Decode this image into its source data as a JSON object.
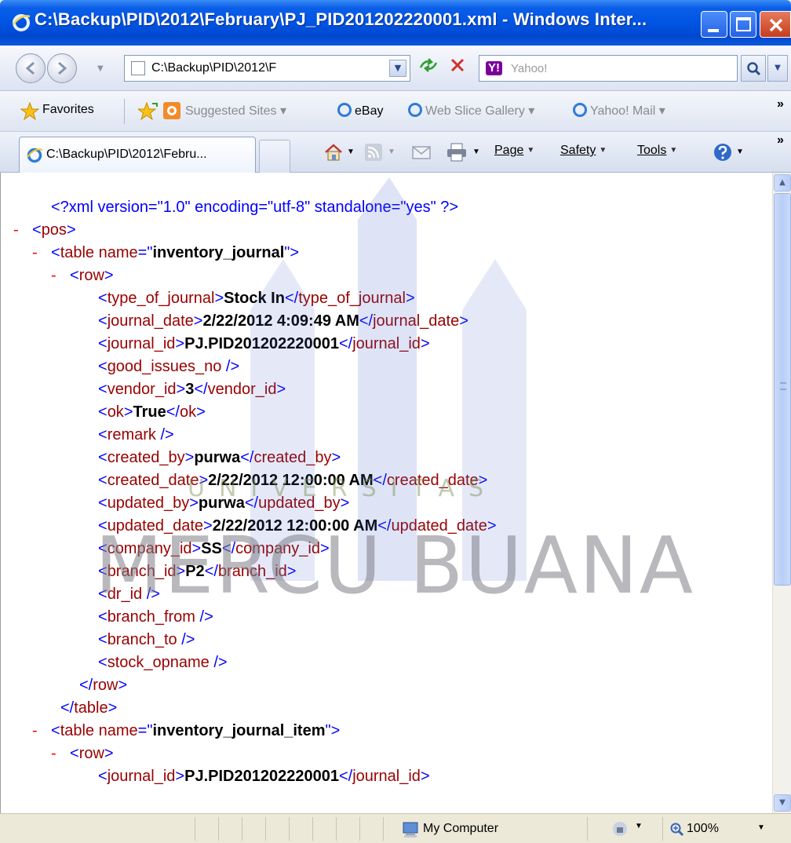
{
  "window": {
    "title": "C:\\Backup\\PID\\2012\\February\\PJ_PID201202220001.xml - Windows Inter..."
  },
  "nav": {
    "address": "C:\\Backup\\PID\\2012\\F",
    "search_placeholder": "Yahoo!",
    "search_provider": "Y!"
  },
  "favorites": {
    "label": "Favorites",
    "items": [
      {
        "label": "Suggested Sites ▾"
      },
      {
        "label": "eBay"
      },
      {
        "label": "Web Slice Gallery ▾"
      },
      {
        "label": "Yahoo! Mail ▾"
      }
    ],
    "overflow": "»"
  },
  "tab": {
    "label": "C:\\Backup\\PID\\2012\\Febru..."
  },
  "commands": {
    "page": "Page",
    "safety": "Safety",
    "tools": "Tools"
  },
  "xml": {
    "declaration": "<?xml version=\"1.0\" encoding=\"utf-8\" standalone=\"yes\" ?>",
    "root": "pos",
    "table1_name": "inventory_journal",
    "row": "row",
    "fields": [
      {
        "tag": "type_of_journal",
        "value": "Stock In"
      },
      {
        "tag": "journal_date",
        "value": "2/22/2012 4:09:49 AM"
      },
      {
        "tag": "journal_id",
        "value": "PJ.PID201202220001"
      },
      {
        "tag": "good_issues_no",
        "value": null
      },
      {
        "tag": "vendor_id",
        "value": "3"
      },
      {
        "tag": "ok",
        "value": "True"
      },
      {
        "tag": "remark",
        "value": null
      },
      {
        "tag": "created_by",
        "value": "purwa"
      },
      {
        "tag": "created_date",
        "value": "2/22/2012 12:00:00 AM"
      },
      {
        "tag": "updated_by",
        "value": "purwa"
      },
      {
        "tag": "updated_date",
        "value": "2/22/2012 12:00:00 AM"
      },
      {
        "tag": "company_id",
        "value": "SS"
      },
      {
        "tag": "branch_id",
        "value": "P2"
      },
      {
        "tag": "dr_id",
        "value": null
      },
      {
        "tag": "branch_from",
        "value": null
      },
      {
        "tag": "branch_to",
        "value": null
      },
      {
        "tag": "stock_opname",
        "value": null
      }
    ],
    "table2_name": "inventory_journal_item",
    "item_fields": [
      {
        "tag": "journal_id",
        "value": "PJ.PID201202220001"
      }
    ]
  },
  "watermark": {
    "main": "MERCU BUANA",
    "sub": "UNIVERSITAS"
  },
  "status": {
    "zone": "My Computer",
    "zoom": "100%"
  }
}
